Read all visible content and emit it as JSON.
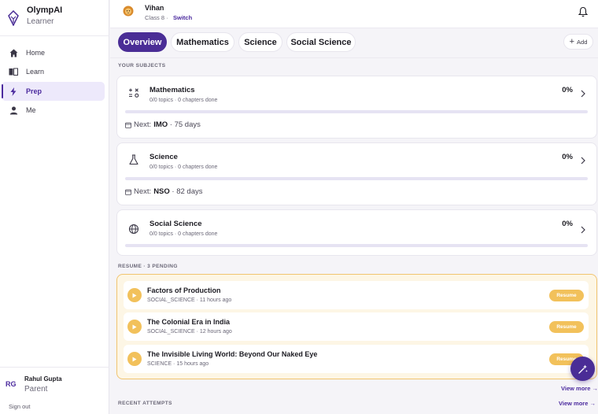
{
  "brand": {
    "name": "OlympAI",
    "subtitle": "Learner"
  },
  "nav": [
    {
      "label": "Home",
      "icon": "home-icon",
      "active": false
    },
    {
      "label": "Learn",
      "icon": "book-icon",
      "active": false
    },
    {
      "label": "Prep",
      "icon": "bolt-icon",
      "active": true
    },
    {
      "label": "Me",
      "icon": "person-icon",
      "active": false
    }
  ],
  "user": {
    "initials": "RG",
    "name": "Rahul Gupta",
    "role": "Parent",
    "signout": "Sign out"
  },
  "profile": {
    "name": "Vihan",
    "class": "Class 8",
    "separator": "·",
    "switch": "Switch"
  },
  "tabs": [
    "Overview",
    "Mathematics",
    "Science",
    "Social Science"
  ],
  "add_label": "Add",
  "sections": {
    "subjects": "YOUR SUBJECTS",
    "resume": "RESUME · 3 PENDING",
    "recent": "RECENT ATTEMPTS"
  },
  "subjects": [
    {
      "title": "Mathematics",
      "meta": "0/0 topics · 0 chapters done",
      "percent": "0%",
      "progress": 0,
      "next_label": "Next:",
      "next_exam": "IMO",
      "next_days": "· 75 days",
      "icon": "math-operators-icon"
    },
    {
      "title": "Science",
      "meta": "0/0 topics · 0 chapters done",
      "percent": "0%",
      "progress": 0,
      "next_label": "Next:",
      "next_exam": "NSO",
      "next_days": "· 82 days",
      "icon": "flask-icon"
    },
    {
      "title": "Social Science",
      "meta": "0/0 topics · 0 chapters done",
      "percent": "0%",
      "progress": 0,
      "icon": "globe-icon"
    }
  ],
  "resume": [
    {
      "title": "Factors of Production",
      "meta": "SOCIAL_SCIENCE · 11 hours ago",
      "button": "Resume"
    },
    {
      "title": "The Colonial Era in India",
      "meta": "SOCIAL_SCIENCE · 12 hours ago",
      "button": "Resume"
    },
    {
      "title": "The Invisible Living World: Beyond Our Naked Eye",
      "meta": "SCIENCE · 15 hours ago",
      "button": "Resume"
    }
  ],
  "view_more": "View more →",
  "colors": {
    "accent": "#4a2d96",
    "resume_accent": "#f2c15b",
    "progress_track": "#e6e3f3"
  }
}
